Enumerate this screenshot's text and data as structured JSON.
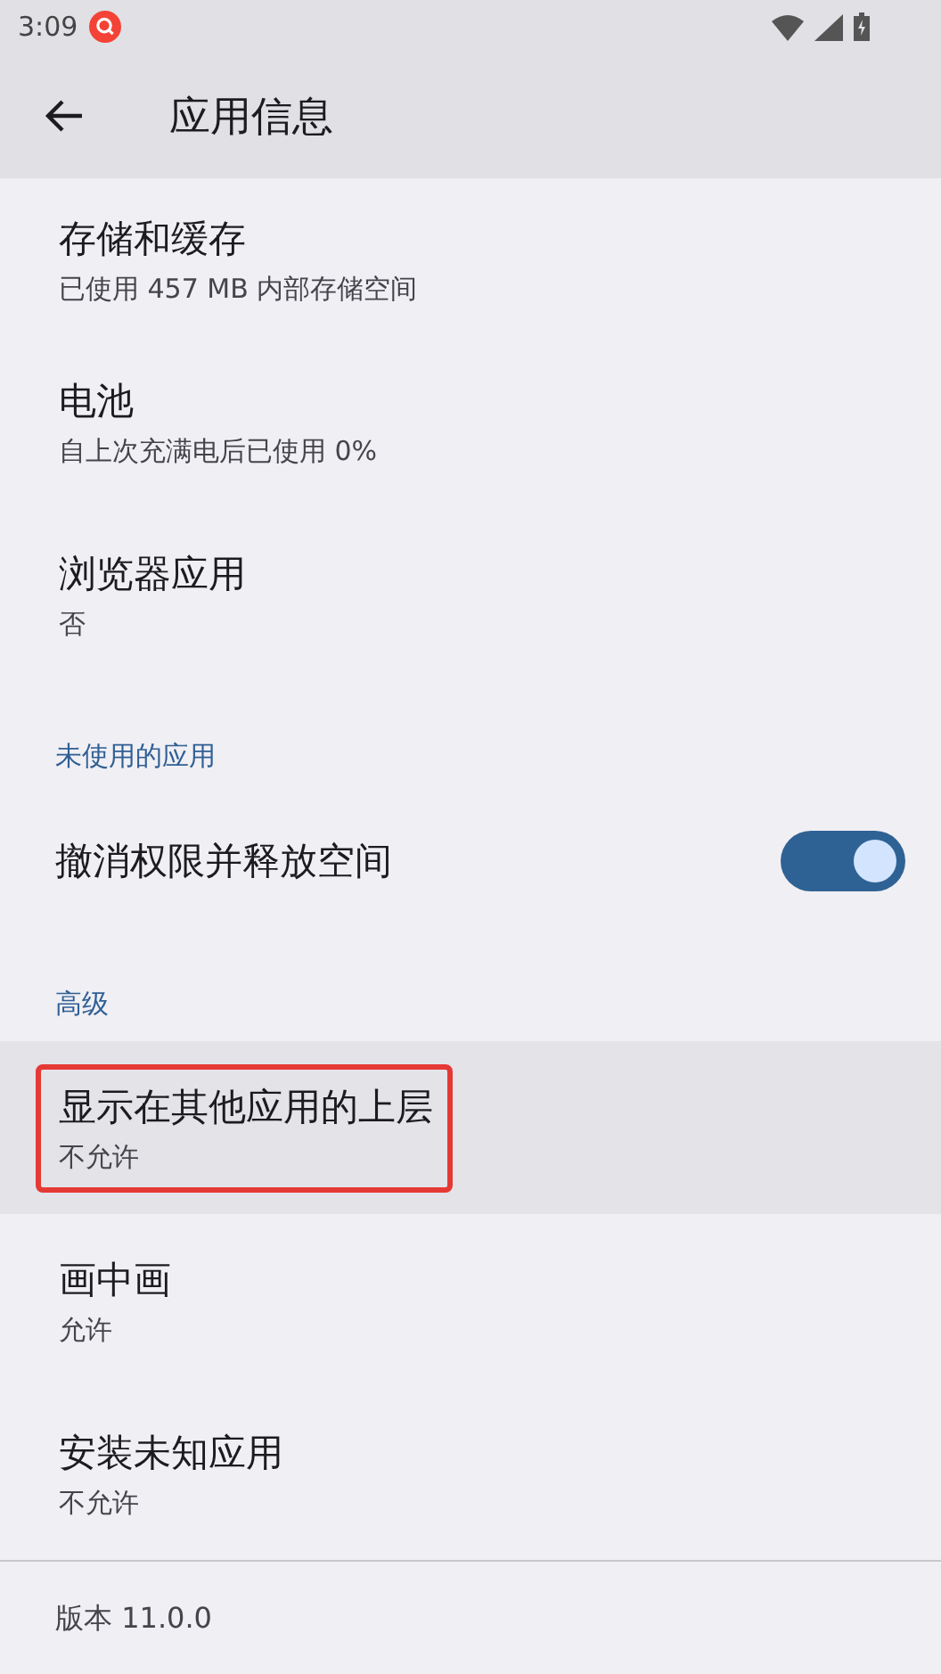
{
  "status_bar": {
    "time": "3:09"
  },
  "toolbar": {
    "title": "应用信息"
  },
  "items": [
    {
      "kind": "setting",
      "title": "存储和缓存",
      "summary": "已使用 457 MB 内部存储空间",
      "selected": false,
      "highlighted": false
    },
    {
      "kind": "setting",
      "title": "电池",
      "summary": "自上次充满电后已使用 0%",
      "selected": false,
      "highlighted": false
    },
    {
      "kind": "setting",
      "title": "浏览器应用",
      "summary": "否",
      "selected": false,
      "highlighted": false
    },
    {
      "kind": "header",
      "title": "未使用的应用"
    },
    {
      "kind": "switch",
      "title": "撤消权限并释放空间",
      "on": true
    },
    {
      "kind": "header",
      "title": "高级"
    },
    {
      "kind": "setting",
      "title": "显示在其他应用的上层",
      "summary": "不允许",
      "selected": true,
      "highlighted": true
    },
    {
      "kind": "setting",
      "title": "画中画",
      "summary": "允许",
      "selected": false,
      "highlighted": false
    },
    {
      "kind": "setting",
      "title": "安装未知应用",
      "summary": "不允许",
      "selected": false,
      "highlighted": false
    }
  ],
  "footer": {
    "text": "版本 11.0.0"
  }
}
